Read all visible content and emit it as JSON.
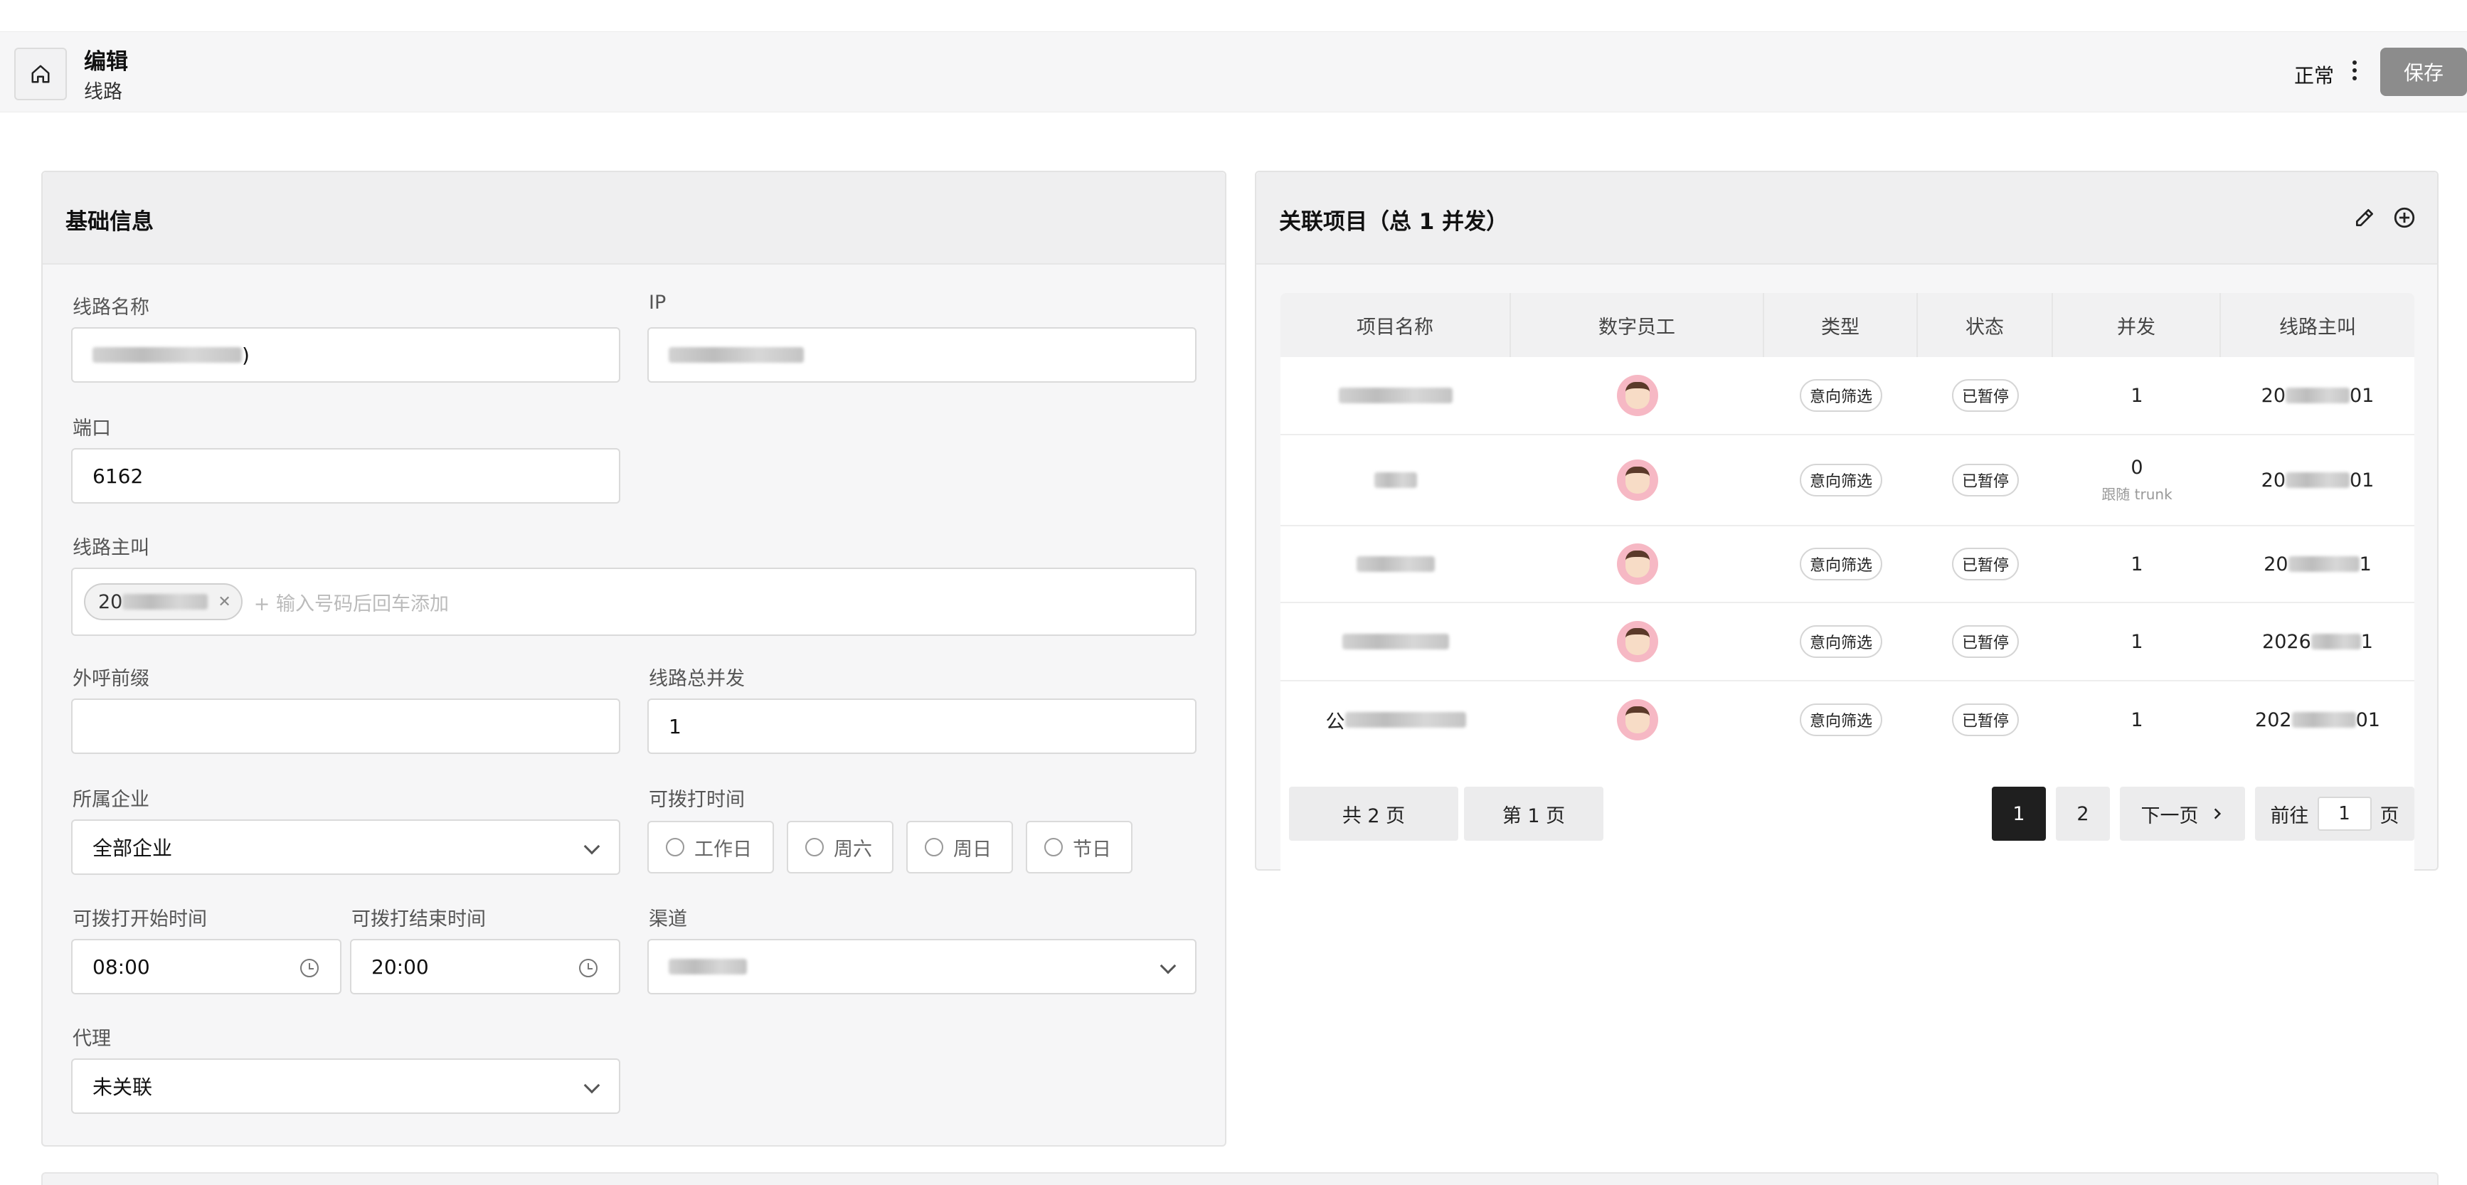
{
  "header": {
    "title": "编辑",
    "subtitle": "线路",
    "status": "正常",
    "save_label": "保存"
  },
  "basic_info": {
    "title": "基础信息",
    "line_name_label": "线路名称",
    "line_name_suffix": ")",
    "ip_label": "IP",
    "port_label": "端口",
    "port_value": "6162",
    "caller_label": "线路主叫",
    "caller_tag_prefix": "20",
    "caller_placeholder": "+ 输入号码后回车添加",
    "prefix_label": "外呼前缀",
    "prefix_value": "",
    "concurrency_label": "线路总并发",
    "concurrency_value": "1",
    "enterprise_label": "所属企业",
    "enterprise_value": "全部企业",
    "dial_time_label": "可拨打时间",
    "dial_options": [
      "工作日",
      "周六",
      "周日",
      "节日"
    ],
    "start_time_label": "可拨打开始时间",
    "start_time_value": "08:00",
    "end_time_label": "可拨打结束时间",
    "end_time_value": "20:00",
    "channel_label": "渠道",
    "agent_label": "代理",
    "agent_value": "未关联"
  },
  "projects": {
    "title": "关联项目（总 1 并发）",
    "columns": [
      "项目名称",
      "数字员工",
      "类型",
      "状态",
      "并发",
      "线路主叫"
    ],
    "rows": [
      {
        "name": "",
        "type": "意向筛选",
        "status": "已暂停",
        "concurrency": "1",
        "note": "",
        "caller_prefix": "20",
        "caller_suffix": "01"
      },
      {
        "name": "",
        "type": "意向筛选",
        "status": "已暂停",
        "concurrency": "0",
        "note": "跟随 trunk",
        "caller_prefix": "20",
        "caller_suffix": "01"
      },
      {
        "name": "",
        "type": "意向筛选",
        "status": "已暂停",
        "concurrency": "1",
        "note": "",
        "caller_prefix": "20",
        "caller_suffix": "1"
      },
      {
        "name": "",
        "type": "意向筛选",
        "status": "已暂停",
        "concurrency": "1",
        "note": "",
        "caller_prefix": "2026",
        "caller_suffix": "1"
      },
      {
        "name": "公",
        "type": "意向筛选",
        "status": "已暂停",
        "concurrency": "1",
        "note": "",
        "caller_prefix": "202",
        "caller_suffix": "01"
      }
    ],
    "total_pages": "共 2 页",
    "current_page": "第 1 页",
    "page_buttons": [
      "1",
      "2"
    ],
    "next_label": "下一页",
    "goto_label": "前往",
    "goto_value": "1",
    "goto_suffix": "页"
  }
}
